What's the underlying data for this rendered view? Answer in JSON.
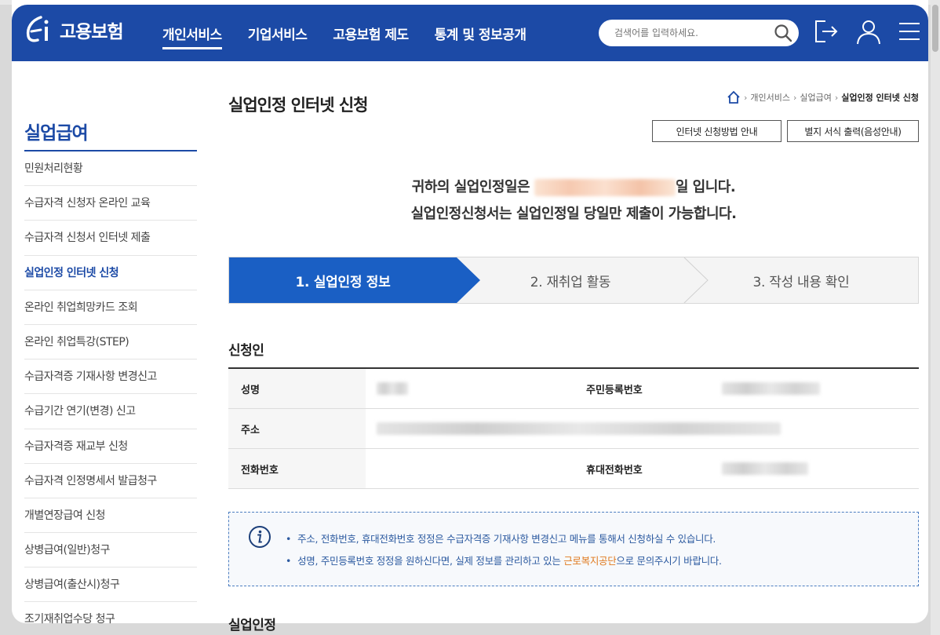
{
  "header": {
    "logo_text": "고용보험",
    "nav": [
      "개인서비스",
      "기업서비스",
      "고용보험 제도",
      "통계 및 정보공개"
    ],
    "search_placeholder": "검색어를 입력하세요.",
    "icons": [
      "search-icon",
      "logout-icon",
      "user-icon",
      "menu-icon"
    ]
  },
  "sidebar": {
    "title": "실업급여",
    "items": [
      "민원처리현황",
      "수급자격 신청자 온라인 교육",
      "수급자격 신청서 인터넷 제출",
      "실업인정 인터넷 신청",
      "온라인 취업희망카드 조회",
      "온라인 취업특강(STEP)",
      "수급자격증 기재사항 변경신고",
      "수급기간 연기(변경) 신고",
      "수급자격증 재교부 신청",
      "수급자격 인정명세서 발급청구",
      "개별연장급여 신청",
      "상병급여(일반)청구",
      "상병급여(출산시)청구",
      "조기재취업수당 청구"
    ],
    "active_index": 3
  },
  "main": {
    "title": "실업인정 인터넷 신청",
    "breadcrumb": [
      "개인서비스",
      "실업급여",
      "실업인정 인터넷 신청"
    ],
    "buttons": {
      "guide": "인터넷 신청방법 안내",
      "print": "별지 서식 출력(음성안내)"
    },
    "notice": {
      "line1_prefix": "귀하의 실업인정일은",
      "line1_suffix": "일 입니다.",
      "line2": "실업인정신청서는 실업인정일 당일만 제출이 가능합니다."
    },
    "steps": [
      "1. 실업인정 정보",
      "2. 재취업 활동",
      "3. 작성 내용 확인"
    ],
    "active_step": 0,
    "applicant": {
      "section_title": "신청인",
      "labels": {
        "name": "성명",
        "resident_no": "주민등록번호",
        "address": "주소",
        "phone": "전화번호",
        "mobile": "휴대전화번호"
      }
    },
    "info": {
      "line1": "주소, 전화번호, 휴대전화번호 정정은 수급자격증 기재사항 변경신고 메뉴를 통해서 신청하실 수 있습니다.",
      "line2_prefix": "성명, 주민등록번호 정정을 원하신다면, 실제 정보를 관리하고 있는 ",
      "line2_highlight": "근로복지공단",
      "line2_suffix": "으로 문의주시기 바랍니다."
    },
    "next_section_title": "실업인정"
  },
  "colors": {
    "brand": "#1c4aa6",
    "step_active": "#1a5fc4",
    "highlight": "#e07a1f"
  }
}
